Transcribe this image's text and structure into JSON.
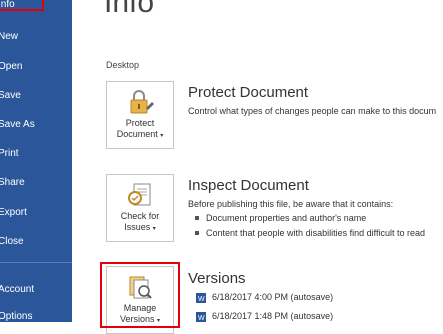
{
  "sidebar": {
    "items": [
      {
        "label": "Info"
      },
      {
        "label": "New"
      },
      {
        "label": "Open"
      },
      {
        "label": "Save"
      },
      {
        "label": "Save As"
      },
      {
        "label": "Print"
      },
      {
        "label": "Share"
      },
      {
        "label": "Export"
      },
      {
        "label": "Close"
      },
      {
        "label": "Account"
      },
      {
        "label": "Options"
      }
    ]
  },
  "main": {
    "title": "Info",
    "location": "Desktop",
    "protect": {
      "button_line1": "Protect",
      "button_line2": "Document",
      "title": "Protect Document",
      "desc": "Control what types of changes people can make to this docum"
    },
    "inspect": {
      "button_line1": "Check for",
      "button_line2": "Issues",
      "title": "Inspect Document",
      "desc": "Before publishing this file, be aware that it contains:",
      "bullets": [
        "Document properties and author's name",
        "Content that people with disabilities find difficult to read"
      ]
    },
    "versions": {
      "button_line1": "Manage",
      "button_line2": "Versions",
      "title": "Versions",
      "rows": [
        "6/18/2017 4:00 PM (autosave)",
        "6/18/2017 1:48 PM (autosave)"
      ]
    }
  },
  "colors": {
    "sidebar": "#2b579a",
    "highlight": "#e3000b"
  }
}
